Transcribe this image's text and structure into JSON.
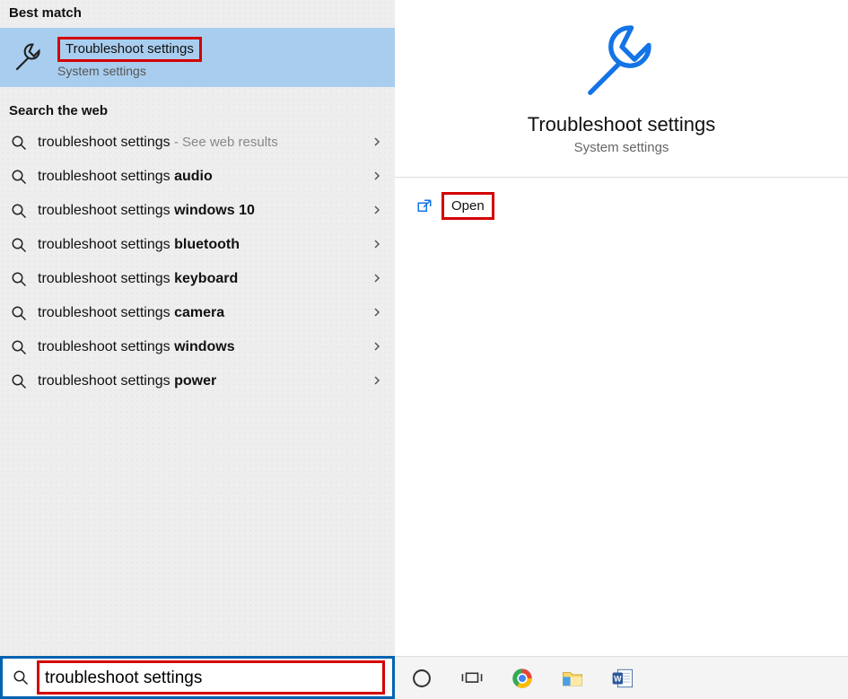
{
  "sections": {
    "best_match_header": "Best match",
    "web_header": "Search the web"
  },
  "best_match": {
    "title": "Troubleshoot settings",
    "subtitle": "System settings"
  },
  "web_results": [
    {
      "prefix": "troubleshoot settings",
      "bold": "",
      "hint": "- See web results"
    },
    {
      "prefix": "troubleshoot settings ",
      "bold": "audio",
      "hint": ""
    },
    {
      "prefix": "troubleshoot settings ",
      "bold": "windows 10",
      "hint": ""
    },
    {
      "prefix": "troubleshoot settings ",
      "bold": "bluetooth",
      "hint": ""
    },
    {
      "prefix": "troubleshoot settings ",
      "bold": "keyboard",
      "hint": ""
    },
    {
      "prefix": "troubleshoot settings ",
      "bold": "camera",
      "hint": ""
    },
    {
      "prefix": "troubleshoot settings ",
      "bold": "windows",
      "hint": ""
    },
    {
      "prefix": "troubleshoot settings ",
      "bold": "power",
      "hint": ""
    }
  ],
  "search": {
    "value": "troubleshoot settings"
  },
  "preview": {
    "title": "Troubleshoot settings",
    "subtitle": "System settings",
    "action_open": "Open"
  },
  "taskbar": {
    "items": [
      "cortana-ring",
      "task-view",
      "chrome",
      "file-explorer",
      "word"
    ]
  },
  "colors": {
    "selection": "#a9cdee",
    "accent": "#0063b1",
    "annotation": "#d30000"
  }
}
